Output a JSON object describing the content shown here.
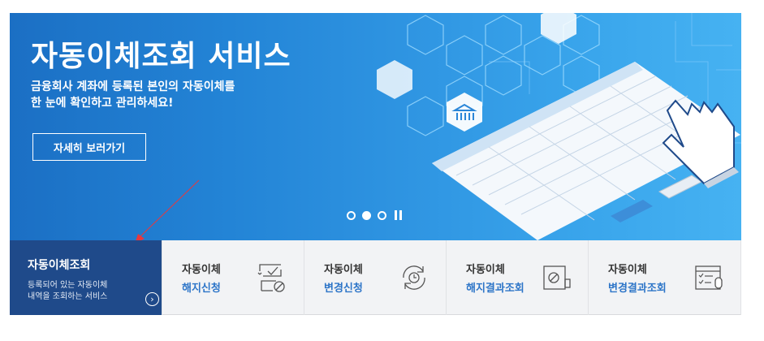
{
  "banner": {
    "title": "자동이체조회 서비스",
    "subtitle_line1": "금융회사 계좌에 등록된 본인의 자동이체를",
    "subtitle_line2": "한 눈에 확인하고 관리하세요!",
    "detail_button": "자세히 보러가기",
    "pager": {
      "count": 3,
      "active_index": 1
    },
    "colors": {
      "gradient_start": "#1b6fc4",
      "gradient_end": "#46b2f2"
    }
  },
  "menu": {
    "active": {
      "title": "자동이체조회",
      "desc_line1": "등록되어 있는 자동이체",
      "desc_line2": "내역을 조회하는 서비스",
      "go_icon": "chevron-right-circle-icon",
      "color": "#1f4a8a"
    },
    "items": [
      {
        "line1": "자동이체",
        "line2": "해지신청",
        "icon": "document-cancel-icon"
      },
      {
        "line1": "자동이체",
        "line2": "변경신청",
        "icon": "clock-refresh-icon"
      },
      {
        "line1": "자동이체",
        "line2": "해지결과조회",
        "icon": "cancel-result-icon"
      },
      {
        "line1": "자동이체",
        "line2": "변경결과조회",
        "icon": "checklist-result-icon"
      }
    ],
    "accent": "#2d75c8"
  }
}
